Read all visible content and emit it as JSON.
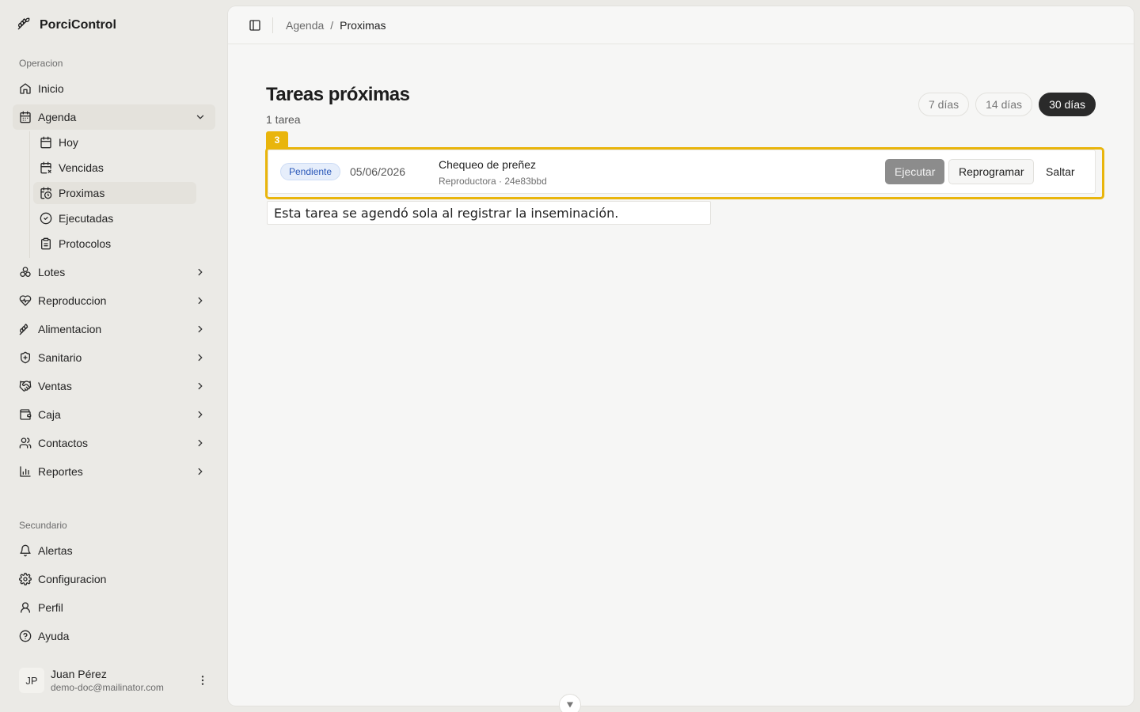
{
  "app": {
    "name": "PorciControl"
  },
  "sidebar": {
    "section_operacion": "Operacion",
    "section_secundario": "Secundario",
    "items": [
      {
        "label": "Inicio",
        "icon": "home-icon"
      },
      {
        "label": "Agenda",
        "icon": "calendar-icon"
      },
      {
        "label": "Lotes",
        "icon": "lots-icon"
      },
      {
        "label": "Reproduccion",
        "icon": "heart-icon"
      },
      {
        "label": "Alimentacion",
        "icon": "wheat-icon"
      },
      {
        "label": "Sanitario",
        "icon": "shield-icon"
      },
      {
        "label": "Ventas",
        "icon": "handshake-icon"
      },
      {
        "label": "Caja",
        "icon": "wallet-icon"
      },
      {
        "label": "Contactos",
        "icon": "users-icon"
      },
      {
        "label": "Reportes",
        "icon": "bar-chart-icon"
      }
    ],
    "agenda_sub": [
      {
        "label": "Hoy",
        "icon": "calendar-day-icon"
      },
      {
        "label": "Vencidas",
        "icon": "calendar-x-icon"
      },
      {
        "label": "Proximas",
        "icon": "calendar-clock-icon"
      },
      {
        "label": "Ejecutadas",
        "icon": "check-circle-icon"
      },
      {
        "label": "Protocolos",
        "icon": "clipboard-icon"
      }
    ],
    "secondary": [
      {
        "label": "Alertas",
        "icon": "bell-icon"
      },
      {
        "label": "Configuracion",
        "icon": "gear-icon"
      },
      {
        "label": "Perfil",
        "icon": "user-icon"
      },
      {
        "label": "Ayuda",
        "icon": "help-circle-icon"
      }
    ],
    "user": {
      "initials": "JP",
      "name": "Juan Pérez",
      "email": "demo-doc@mailinator.com"
    }
  },
  "breadcrumb": {
    "parent": "Agenda",
    "separator": "/",
    "current": "Proximas"
  },
  "page": {
    "title": "Tareas próximas",
    "count": "1 tarea",
    "filters": [
      "7 días",
      "14 días",
      "30 días"
    ],
    "active_filter": "30 días"
  },
  "task": {
    "marker": "3",
    "status": "Pendiente",
    "date": "05/06/2026",
    "title": "Chequeo de preñez",
    "meta": "Reproductora · 24e83bbd",
    "actions": {
      "execute": "Ejecutar",
      "reschedule": "Reprogramar",
      "skip": "Saltar"
    },
    "tooltip": "Esta tarea se agendó sola al registrar la inseminación."
  },
  "colors": {
    "highlight": "#e9b50c",
    "active_pill": "#2a2a2a",
    "status_blue": "#2856b8"
  }
}
